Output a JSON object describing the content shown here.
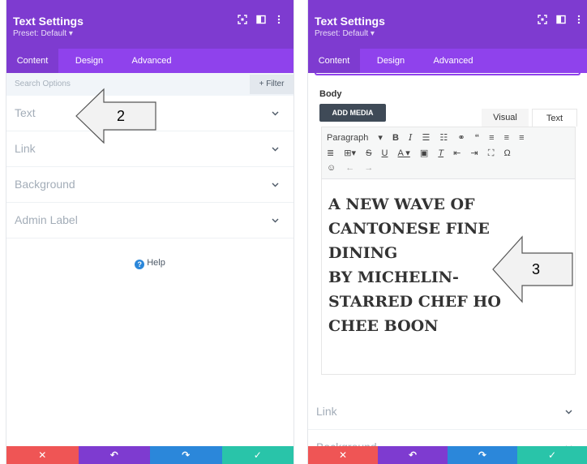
{
  "left_panel": {
    "title": "Text Settings",
    "preset": "Preset: Default ▾",
    "tabs": [
      {
        "label": "Content",
        "active": true
      },
      {
        "label": "Design",
        "active": false
      },
      {
        "label": "Advanced",
        "active": false
      }
    ],
    "search_placeholder": "Search Options",
    "filter_label": "+ Filter",
    "sections": [
      {
        "label": "Text"
      },
      {
        "label": "Link"
      },
      {
        "label": "Background"
      },
      {
        "label": "Admin Label"
      }
    ],
    "help_label": "Help",
    "annotation": "2"
  },
  "right_panel": {
    "title": "Text Settings",
    "preset": "Preset: Default ▾",
    "tabs": [
      {
        "label": "Content",
        "active": true
      },
      {
        "label": "Design",
        "active": false
      },
      {
        "label": "Advanced",
        "active": false
      }
    ],
    "body_label": "Body",
    "add_media_label": "ADD MEDIA",
    "visual_tab": "Visual",
    "text_tab": "Text",
    "format_select": "Paragraph",
    "content_lines": [
      "A NEW WAVE OF",
      "CANTONESE FINE",
      "DINING",
      "BY MICHELIN-",
      "STARRED CHEF HO",
      "CHEE BOON"
    ],
    "sections": [
      {
        "label": "Link"
      },
      {
        "label": "Background"
      }
    ],
    "annotation": "3"
  },
  "footer": {
    "cancel": "✕",
    "undo": "↶",
    "redo": "↷",
    "save": "✓"
  },
  "colors": {
    "header": "#7e3bd0",
    "tabbar": "#8f42ec",
    "cancel": "#ef5555",
    "redo": "#2b87da",
    "save": "#29c4a9"
  }
}
